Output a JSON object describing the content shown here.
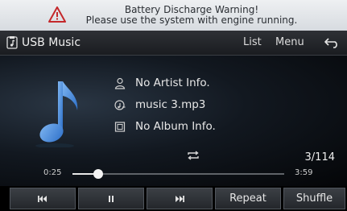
{
  "warning": {
    "line1": "Battery Discharge Warning!",
    "line2": "Please use the system with engine running.",
    "icon": "warning-triangle-icon"
  },
  "header": {
    "title": "USB Music",
    "list_label": "List",
    "menu_label": "Menu",
    "back_icon": "back-arrow-icon"
  },
  "track": {
    "artist": "No Artist Info.",
    "title": "music 3.mp3",
    "album": "No Album Info.",
    "counter": "3/114",
    "repeat_icon": "repeat-icon"
  },
  "playback": {
    "current_time": "0:25",
    "total_time": "3:59",
    "progress_fraction": 0.12
  },
  "controls": {
    "prev_icon": "skip-previous-icon",
    "pause_icon": "pause-icon",
    "next_icon": "skip-next-icon",
    "repeat_label": "Repeat",
    "shuffle_label": "Shuffle"
  },
  "colors": {
    "accent_note": "#4a8fe0",
    "background": "#000000"
  }
}
